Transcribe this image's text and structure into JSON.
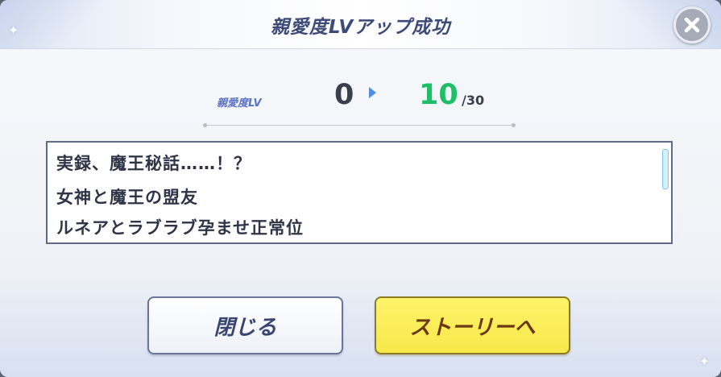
{
  "dialog": {
    "title": "親愛度LVアップ成功"
  },
  "level": {
    "label": "親愛度LV",
    "old": "0",
    "new": "10",
    "max": "/30"
  },
  "story_list": {
    "lines": [
      "実録、魔王秘話……！？",
      "女神と魔王の盟友",
      "ルネアとラブラブ孕ませ正常位"
    ]
  },
  "buttons": {
    "close_label": "閉じる",
    "story_label": "ストーリーへ"
  },
  "colors": {
    "title": "#3e4a78",
    "level_new": "#1fbf6a",
    "story_button": "#f7e84a"
  },
  "icons": {
    "close": "close-icon",
    "arrow": "arrow-right-icon",
    "sparkle": "sparkle-icon"
  }
}
